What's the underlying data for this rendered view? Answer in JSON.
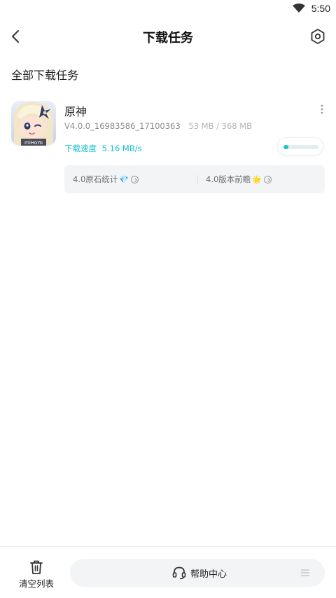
{
  "status_bar": {
    "time": "5:50",
    "wifi_icon": "wifi-icon"
  },
  "header": {
    "title": "下载任务",
    "back_icon": "back-arrow-icon",
    "settings_icon": "settings-hexagon-icon"
  },
  "section": {
    "title": "全部下载任务"
  },
  "task": {
    "name": "原神",
    "version": "V4.0.0_16983586_17100363",
    "size": "53 MB / 368 MB",
    "speed_label": "下载速度",
    "speed_value": "5.16 MB/s",
    "progress": 0.144,
    "icon_logo": "miHoYo",
    "links": [
      {
        "label": "4.0原石统计",
        "emoji": "💎"
      },
      {
        "label": "4.0版本前瞻",
        "emoji": "🌟"
      }
    ]
  },
  "bottom": {
    "clear_label": "清空列表",
    "help_label": "帮助中心"
  },
  "colors": {
    "accent": "#1bc4d6",
    "text": "#222222",
    "muted": "#8a8a8a",
    "panel": "#f3f4f6"
  }
}
